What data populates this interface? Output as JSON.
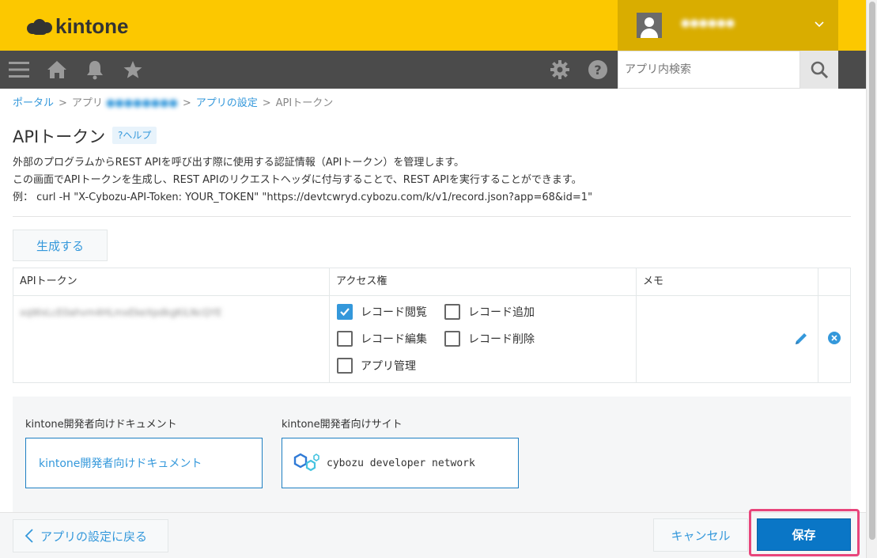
{
  "header": {
    "logo_text": "kintone",
    "user_name": "●●●●●●",
    "colors": {
      "brand_yellow": "#fcc800",
      "user_area": "#d9ad00",
      "toolbar": "#4b4b4b",
      "accent_blue": "#3498db",
      "save_blue": "#0a76c6",
      "highlight_pink": "#e8457b"
    }
  },
  "toolbar": {
    "icons": [
      "menu-icon",
      "home-icon",
      "bell-icon",
      "star-icon",
      "gear-icon",
      "help-icon",
      "search-icon"
    ],
    "search_placeholder": "アプリ内検索"
  },
  "breadcrumb": {
    "portal": "ポータル",
    "app": "アプリ",
    "app_name": "●●●●●●●●",
    "app_settings": "アプリの設定",
    "current": "APIトークン",
    "separator": ">"
  },
  "page": {
    "title": "APIトークン",
    "help_label": "?ヘルプ",
    "desc_line1": "外部のプログラムからREST APIを呼び出す際に使用する認証情報（APIトークン）を管理します。",
    "desc_line2": "この画面でAPIトークンを生成し、REST APIのリクエストヘッダに付与することで、REST APIを実行することができます。",
    "desc_line3": "例： curl -H \"X-Cybozu-API-Token: YOUR_TOKEN\" \"https://devtcwryd.cybozu.com/k/v1/record.json?app=68&id=1\"",
    "generate_label": "生成する"
  },
  "token_table": {
    "headers": [
      "APIトークン",
      "アクセス権",
      "メモ",
      ""
    ],
    "rows": [
      {
        "token": "xqWxLcE0ahvm4HLmxEkeXpdkgKiLNcQYE",
        "memo": "",
        "permissions": [
          {
            "label": "レコード閲覧",
            "checked": true
          },
          {
            "label": "レコード追加",
            "checked": false
          },
          {
            "label": "レコード編集",
            "checked": false
          },
          {
            "label": "レコード削除",
            "checked": false
          },
          {
            "label": "アプリ管理",
            "checked": false
          }
        ]
      }
    ]
  },
  "docs": {
    "doc_title": "kintone開発者向けドキュメント",
    "doc_link": "kintone開発者向けドキュメント",
    "site_title": "kintone開発者向けサイト",
    "site_link": "cybozu developer network"
  },
  "footer": {
    "back_label": "アプリの設定に戻る",
    "cancel_label": "キャンセル",
    "save_label": "保存"
  }
}
